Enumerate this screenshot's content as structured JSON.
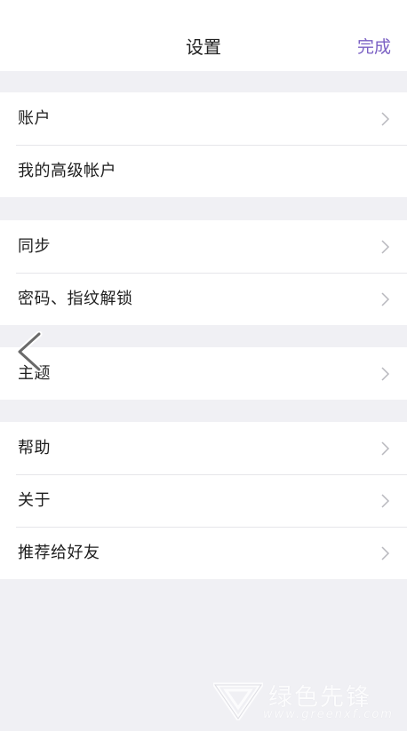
{
  "header": {
    "title": "设置",
    "done_label": "完成"
  },
  "groups": [
    {
      "items": [
        {
          "label": "账户",
          "chevron": true
        },
        {
          "label": "我的高级帐户",
          "chevron": false
        }
      ]
    },
    {
      "items": [
        {
          "label": "同步",
          "chevron": true
        },
        {
          "label": "密码、指纹解锁",
          "chevron": true
        }
      ]
    },
    {
      "items": [
        {
          "label": "主题",
          "chevron": true
        }
      ]
    },
    {
      "items": [
        {
          "label": "帮助",
          "chevron": true
        },
        {
          "label": "关于",
          "chevron": true
        },
        {
          "label": "推荐给好友",
          "chevron": true
        }
      ]
    }
  ],
  "watermark": {
    "text": "绿色先锋",
    "url": "www.greenxf.com"
  },
  "colors": {
    "accent": "#7b61c4",
    "background": "#f0f0f4",
    "chevron": "#b8b8be"
  },
  "icons": {
    "row_chevron": "chevron-right-icon",
    "back": "chevron-left-icon"
  }
}
